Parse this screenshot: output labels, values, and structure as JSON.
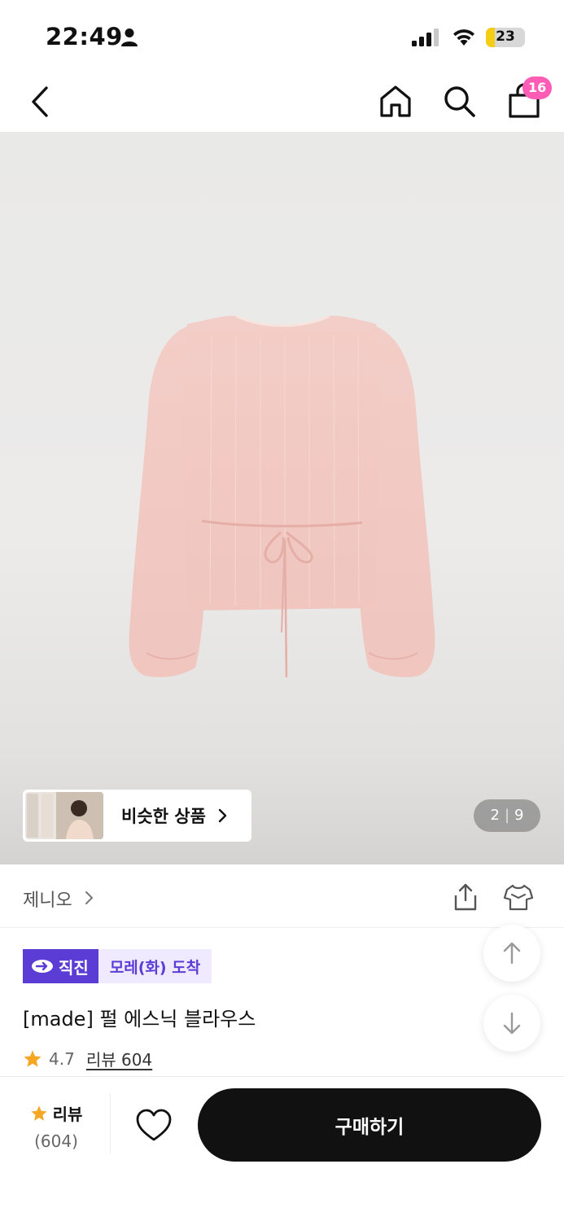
{
  "status_bar": {
    "time": "22:49",
    "battery_level": "23",
    "battery_fill_percent": 23,
    "battery_color": "#f5cc16"
  },
  "nav": {
    "back_icon": "chevron-left-icon",
    "home_icon": "home-icon",
    "search_icon": "search-icon",
    "cart_icon": "shopping-bag-icon",
    "cart_count": "16",
    "badge_color": "#ff5cb6"
  },
  "hero": {
    "similar_products_label": "비슷한 상품",
    "page_current": "2",
    "page_total": "9"
  },
  "brand": {
    "name": "제니오"
  },
  "product": {
    "tag_direct": "직진",
    "tag_arrival": "모레(화) 도착",
    "title": "[made] 펄 에스닉 블라우스",
    "rating": "4.7",
    "review_link": "리뷰 604",
    "accent_color": "#5b3dd6",
    "star_color": "#f5a623"
  },
  "bottom_bar": {
    "review_label": "리뷰",
    "review_count": "(604)",
    "buy_label": "구매하기"
  }
}
